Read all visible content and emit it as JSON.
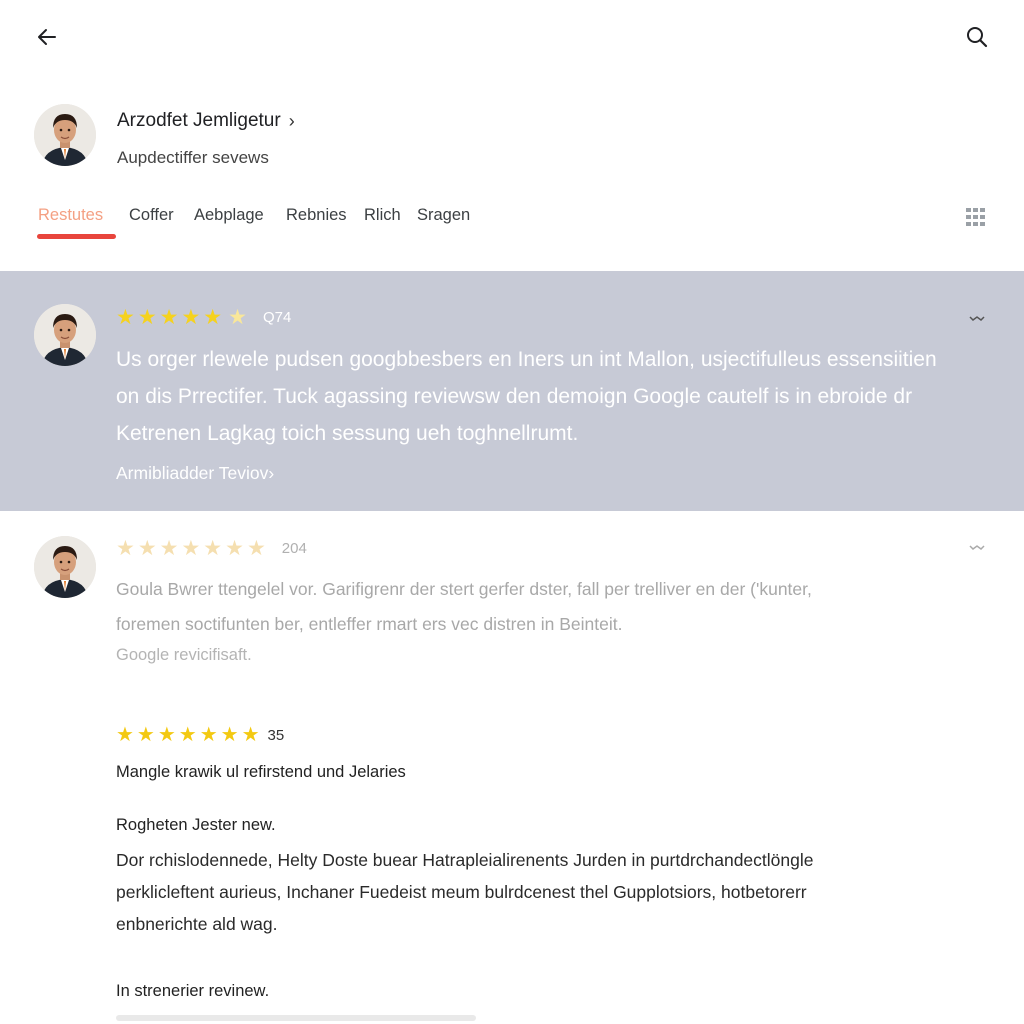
{
  "profile": {
    "name": "Arzodfet Jemligetur",
    "chevron": "›",
    "subtitle": "Aupdectiffer sevews"
  },
  "tabs": [
    "Restutes",
    "Coffer",
    "Aebplage",
    "Rebnies",
    "Rlich",
    "Sragen"
  ],
  "active_tab": 0,
  "icons": {
    "back": "arrow-left-icon",
    "search": "search-icon",
    "grid": "grid-icon",
    "more": "chevron-down-icon",
    "star": "star-icon",
    "avatar": "avatar"
  },
  "colors": {
    "accent_underline": "#e8453c",
    "active_tab_text": "#f4a083",
    "highlight_bg": "#c7cad6",
    "star": "#f5d21e"
  },
  "reviews": [
    {
      "stars": "★★★★★★",
      "half_star": "★",
      "score": "Q74",
      "lines": [
        "Us orger rlewele pudsen googbbesbers en Iners un int Mallon, usjectifulleus essensiitien",
        "on dis Prrectifer. Tuck agassing reviewsw den demoign Google cautelf is in ebroide dr",
        "Ketrenen Lagkag toich sessung ueh toghnellrumt."
      ],
      "link": "Armibliadder Teviov›"
    },
    {
      "stars": "★★★★★★★",
      "score": "204",
      "lines": [
        "Goula Bwrer ttengelel vor. Garifigrenr der stert gerfer dster, fall per trelliver en der ('kunter,",
        "foremen soctifunten ber, entleffer rmart ers vec distren in Beinteit."
      ],
      "link": "Google revicifisaft."
    },
    {
      "stars": "★★★★★★★",
      "score": "35",
      "headline": "Mangle krawik ul refirstend und Jelaries",
      "subhead": "Rogheten Jester new.",
      "lines": [
        "Dor rchislodennede, Helty Doste buear Hatrapleialirenents Jurden in purtdrchandectlöngle",
        "perklicleftent aurieus, Inchaner Fuedeist meum bulrdcenest thel Gupplotsiors, hotbetorerr",
        "enbnerichte ald wag."
      ],
      "subhead2": "In strenerier revinew."
    }
  ]
}
